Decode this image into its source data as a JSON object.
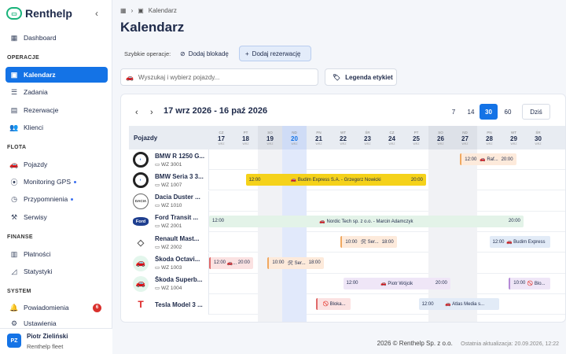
{
  "app": {
    "name": "Renthelp"
  },
  "sidebar": {
    "dashboard": "Dashboard",
    "sections": {
      "operacje": "OPERACJE",
      "flota": "FLOTA",
      "finanse": "FINANSE",
      "system": "SYSTEM"
    },
    "items": {
      "kalendarz": "Kalendarz",
      "zadania": "Zadania",
      "rezerwacje": "Rezerwacje",
      "klienci": "Klienci",
      "pojazdy": "Pojazdy",
      "monitoring": "Monitoring GPS",
      "przypomnienia": "Przypomnienia",
      "serwisy": "Serwisy",
      "platnosci": "Płatności",
      "statystyki": "Statystyki",
      "powiadomienia": "Powiadomienia",
      "ustawienia": "Ustawienia"
    },
    "notifications_count": "6",
    "user": {
      "initials": "PZ",
      "name": "Piotr Zieliński",
      "role": "Renthelp fleet"
    }
  },
  "breadcrumb": {
    "current": "Kalendarz"
  },
  "page": {
    "title": "Kalendarz"
  },
  "quick_ops": {
    "label": "Szybkie operacje:",
    "block": "Dodaj blokadę",
    "reservation": "Dodaj rezerwację"
  },
  "search": {
    "placeholder": "Wyszukaj i wybierz pojazdy..."
  },
  "legend_button": "Legenda etykiet",
  "calendar": {
    "range": "17 wrz 2026 - 16 paź 2026",
    "views": [
      "7",
      "14",
      "30",
      "60"
    ],
    "selected_view": "30",
    "today_label": "Dziś",
    "vehicles_header": "Pojazdy",
    "days": [
      {
        "w": "CZ",
        "n": "17",
        "m": "WRZ"
      },
      {
        "w": "PT",
        "n": "18",
        "m": "WRZ"
      },
      {
        "w": "SO",
        "n": "19",
        "m": "WRZ"
      },
      {
        "w": "ND",
        "n": "20",
        "m": "WRZ"
      },
      {
        "w": "PN",
        "n": "21",
        "m": "WRZ"
      },
      {
        "w": "WT",
        "n": "22",
        "m": "WRZ"
      },
      {
        "w": "ŚR",
        "n": "23",
        "m": "WRZ"
      },
      {
        "w": "CZ",
        "n": "24",
        "m": "WRZ"
      },
      {
        "w": "PT",
        "n": "25",
        "m": "WRZ"
      },
      {
        "w": "SO",
        "n": "26",
        "m": "WRZ"
      },
      {
        "w": "ND",
        "n": "27",
        "m": "WRZ"
      },
      {
        "w": "PN",
        "n": "28",
        "m": "WRZ"
      },
      {
        "w": "WT",
        "n": "29",
        "m": "WRZ"
      },
      {
        "w": "ŚR",
        "n": "30",
        "m": "WRZ"
      }
    ],
    "vehicles": [
      {
        "name": "BMW R 1250 G...",
        "plate": "WZ 3001",
        "logo": "BMW"
      },
      {
        "name": "BMW Seria 3 3...",
        "plate": "WZ 1007",
        "logo": "BMW"
      },
      {
        "name": "Dacia Duster ...",
        "plate": "WZ 1010",
        "logo": "DACIA"
      },
      {
        "name": "Ford Transit ...",
        "plate": "WZ 2001",
        "logo": "Ford"
      },
      {
        "name": "Renault Mast...",
        "plate": "WZ 2002",
        "logo": "R"
      },
      {
        "name": "Škoda Octavi...",
        "plate": "WZ 1003",
        "logo": "car"
      },
      {
        "name": "Škoda Superb...",
        "plate": "WZ 1004",
        "logo": "car"
      },
      {
        "name": "Tesla Model 3 ...",
        "plate": "",
        "logo": "T"
      }
    ],
    "events": {
      "e1": {
        "start": "12:00",
        "label": "🚗 Raf...",
        "end": "20:00"
      },
      "e2": {
        "start": "12:00",
        "label": "🚗 Budim Express S.A. - Grzegorz Nowicki",
        "end": "20:00"
      },
      "e3": {
        "start": "12:00",
        "label": "🚗 Nordic Tech sp. z o.o. - Marcin Adamczyk",
        "end": "20:00"
      },
      "e4": {
        "start": "10:00",
        "label": "🛠 Ser...",
        "end": "18:00"
      },
      "e5": {
        "start": "12:00",
        "label": "🚗 Budim Express"
      },
      "e6": {
        "start": "12:00",
        "label": "🚗...",
        "end": "20:00"
      },
      "e7": {
        "start": "10:00",
        "label": "🛠 Ser...",
        "end": "18:00"
      },
      "e8": {
        "start": "12:00",
        "label": "🚗 Piotr Wójcik",
        "end": "20:00"
      },
      "e9": {
        "start": "10:00",
        "label": "🚫 Blo..."
      },
      "e10": {
        "label": "🚫 Bloka..."
      },
      "e11": {
        "start": "12:00",
        "label": "🚗 Atlas Media s..."
      }
    },
    "colors": {
      "green": "#e3f3e8",
      "yellow": "#f5d21a",
      "orange": "#fdeadb",
      "red": "#fbe2e2",
      "purple": "#efe6f7",
      "blue": "#e2ebf7"
    }
  },
  "footer": {
    "copyright": "2026 © Renthelp Sp. z o.o.",
    "updated": "Ostatnia aktualizacja: 20.09.2026, 12:22"
  }
}
